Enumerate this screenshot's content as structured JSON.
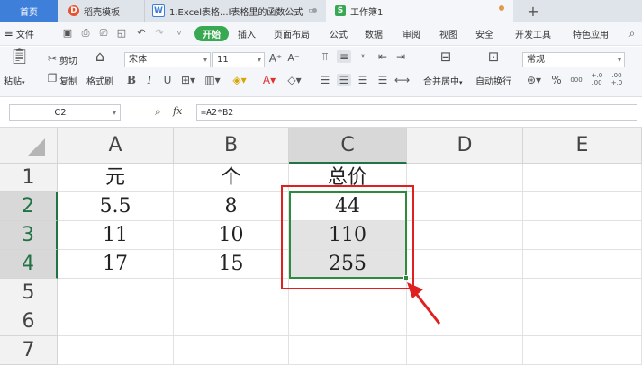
{
  "tabs": {
    "home": "首页",
    "daoke": "稻壳模板",
    "doc": "1.Excel表格...l表格里的函数公式",
    "workbook": "工作簿1",
    "plus": "+"
  },
  "menu": {
    "file": "文件",
    "start": "开始",
    "insert": "插入",
    "page_layout": "页面布局",
    "formula": "公式",
    "data": "数据",
    "review": "审阅",
    "view": "视图",
    "security": "安全",
    "dev_tools": "开发工具",
    "special": "特色应用"
  },
  "ribbon": {
    "cut": "剪切",
    "copy": "复制",
    "paste": "粘贴",
    "format_painter": "格式刷",
    "font_name": "宋体",
    "font_size": "11",
    "merge_center": "合并居中",
    "wrap_text": "自动换行",
    "number_format": "常规",
    "percent": "%",
    "thousands": "000",
    "inc_dec": "+.0 .00",
    "dec_dec": ".00 +.0"
  },
  "formula_bar": {
    "cell_ref": "C2",
    "fx": "fx",
    "formula": "=A2*B2"
  },
  "columns": [
    "A",
    "B",
    "C",
    "D",
    "E"
  ],
  "rows": [
    "1",
    "2",
    "3",
    "4",
    "5",
    "6",
    "7"
  ],
  "cells": {
    "A1": "元",
    "B1": "个",
    "C1": "总价",
    "A2": "5.5",
    "B2": "8",
    "C2": "44",
    "A3": "11",
    "B3": "10",
    "C3": "110",
    "A4": "17",
    "B4": "15",
    "C4": "255"
  },
  "colors": {
    "selection_border": "#2e8b3e",
    "highlight_box": "#e02020",
    "start_tab": "#39a853",
    "home_tab": "#3d7fd9"
  }
}
